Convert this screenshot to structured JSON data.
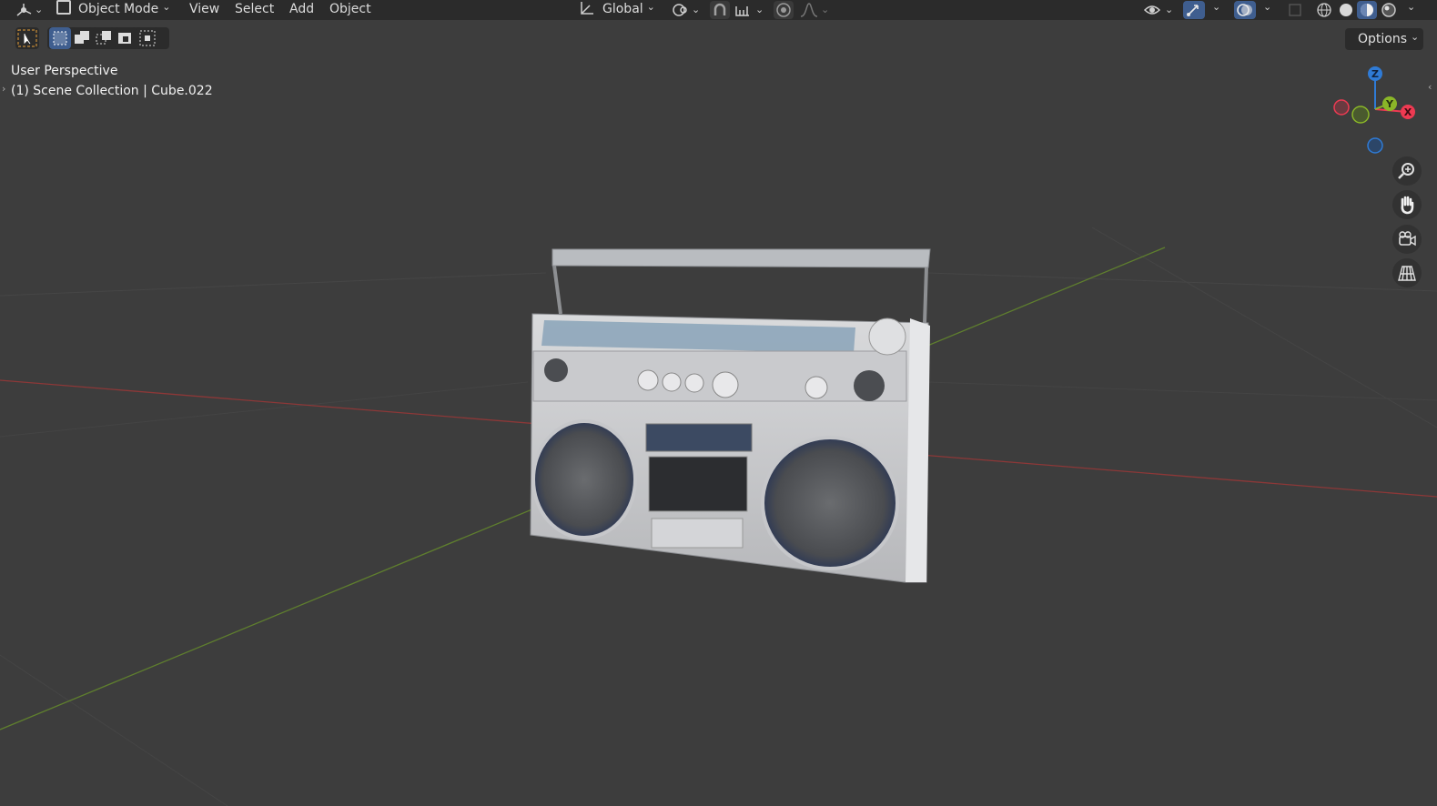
{
  "header": {
    "editor_type_icon": "3d-viewport-icon",
    "mode": "Object Mode",
    "menus": [
      "View",
      "Select",
      "Add",
      "Object"
    ],
    "transform_orientation": "Global",
    "options_label": "Options"
  },
  "viewport": {
    "view_name": "User Perspective",
    "collection_info": "(1) Scene Collection | Cube.022",
    "object_description": "boombox-3d-model"
  },
  "gizmo": {
    "axes": [
      "X",
      "Y",
      "Z"
    ],
    "colors": {
      "x": "#ee3a52",
      "y": "#8ab628",
      "z": "#2f7bd6",
      "grid_x": "#8c3838",
      "grid_y": "#5f7f2e"
    }
  },
  "nav_buttons": [
    "zoom-icon",
    "hand-pan-icon",
    "camera-view-icon",
    "grid-ortho-icon"
  ],
  "tools": [
    "select-cursor-icon",
    "select-box-new-icon",
    "select-box-extend-icon",
    "select-box-subtract-icon",
    "select-box-invert-icon",
    "select-box-intersect-icon"
  ]
}
